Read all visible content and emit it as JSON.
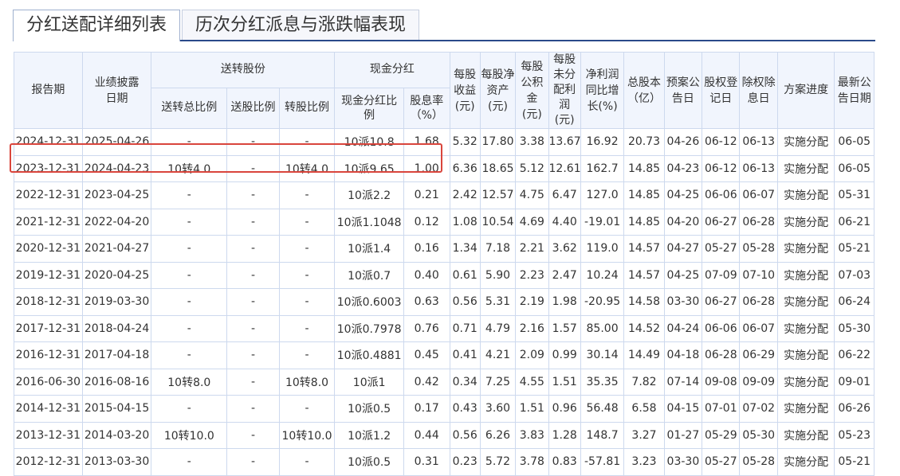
{
  "tabs": [
    {
      "label": "分红送配详细列表",
      "active": true
    },
    {
      "label": "历次分红派息与涨跌幅表现",
      "active": false
    }
  ],
  "header": {
    "report_period": "报告期",
    "disclosure_date": "业绩披露日期",
    "bonus_group": "送转股份",
    "bonus_total": "送转总比例",
    "bonus_ratio": "送股比例",
    "transfer_ratio": "转股比例",
    "cash_group": "现金分红",
    "cash_plan": "现金分红比例",
    "dividend_yield": "股息率（%）",
    "eps": "每股收益(元)",
    "bvps": "每股净资产(元)",
    "reserve": "每股公积金(元)",
    "undistributed": "每股未分配利润(元)",
    "profit_growth": "净利润同比增长(%)",
    "total_shares": "总股本（亿）",
    "plan_date": "预案公告日",
    "record_date": "股权登记日",
    "ex_date": "除权除息日",
    "progress": "方案进度",
    "latest_date": "最新公告日期"
  },
  "rows": [
    [
      "2024-12-31",
      "2025-04-26",
      "-",
      "-",
      "-",
      "10派10.8",
      "1.68",
      "5.32",
      "17.80",
      "3.38",
      "13.67",
      "16.92",
      "20.73",
      "04-26",
      "06-12",
      "06-13",
      "实施分配",
      "06-05"
    ],
    [
      "2023-12-31",
      "2024-04-23",
      "10转4.0",
      "-",
      "10转4.0",
      "10派9.65",
      "1.00",
      "6.36",
      "18.65",
      "5.12",
      "12.61",
      "162.7",
      "14.85",
      "04-23",
      "06-12",
      "06-13",
      "实施分配",
      "06-05"
    ],
    [
      "2022-12-31",
      "2023-04-25",
      "-",
      "-",
      "-",
      "10派2.2",
      "0.21",
      "2.42",
      "12.57",
      "4.75",
      "6.47",
      "127.0",
      "14.85",
      "04-25",
      "06-06",
      "06-07",
      "实施分配",
      "05-31"
    ],
    [
      "2021-12-31",
      "2022-04-20",
      "-",
      "-",
      "-",
      "10派1.1048",
      "0.12",
      "1.08",
      "10.54",
      "4.69",
      "4.40",
      "-19.01",
      "14.85",
      "04-20",
      "06-27",
      "06-28",
      "实施分配",
      "06-21"
    ],
    [
      "2020-12-31",
      "2021-04-27",
      "-",
      "-",
      "-",
      "10派1.4",
      "0.16",
      "1.34",
      "7.18",
      "2.21",
      "3.62",
      "119.0",
      "14.57",
      "04-27",
      "05-27",
      "05-28",
      "实施分配",
      "05-21"
    ],
    [
      "2019-12-31",
      "2020-04-25",
      "-",
      "-",
      "-",
      "10派0.7",
      "0.40",
      "0.61",
      "5.90",
      "2.23",
      "2.47",
      "10.24",
      "14.57",
      "04-25",
      "07-09",
      "07-10",
      "实施分配",
      "07-03"
    ],
    [
      "2018-12-31",
      "2019-03-30",
      "-",
      "-",
      "-",
      "10派0.6003",
      "0.63",
      "0.56",
      "5.31",
      "2.19",
      "1.98",
      "-20.95",
      "14.58",
      "03-30",
      "06-27",
      "06-28",
      "实施分配",
      "06-24"
    ],
    [
      "2017-12-31",
      "2018-04-24",
      "-",
      "-",
      "-",
      "10派0.7978",
      "0.76",
      "0.71",
      "4.79",
      "2.16",
      "1.57",
      "85.00",
      "14.52",
      "04-24",
      "06-06",
      "06-07",
      "实施分配",
      "05-30"
    ],
    [
      "2016-12-31",
      "2017-04-18",
      "-",
      "-",
      "-",
      "10派0.4881",
      "0.45",
      "0.41",
      "4.21",
      "2.09",
      "0.99",
      "30.14",
      "14.49",
      "04-18",
      "06-28",
      "06-29",
      "实施分配",
      "06-22"
    ],
    [
      "2016-06-30",
      "2016-08-16",
      "10转8.0",
      "-",
      "10转8.0",
      "10派1",
      "0.42",
      "0.34",
      "7.25",
      "4.55",
      "1.51",
      "35.35",
      "7.82",
      "07-14",
      "09-08",
      "09-09",
      "实施分配",
      "09-01"
    ],
    [
      "2014-12-31",
      "2015-04-15",
      "-",
      "-",
      "-",
      "10派0.5",
      "0.17",
      "0.43",
      "3.60",
      "1.51",
      "0.96",
      "56.48",
      "6.58",
      "04-15",
      "07-01",
      "07-02",
      "实施分配",
      "06-26"
    ],
    [
      "2013-12-31",
      "2014-03-20",
      "10转10.0",
      "-",
      "10转10.0",
      "10派1.2",
      "0.44",
      "0.56",
      "6.26",
      "3.83",
      "1.28",
      "148.7",
      "3.27",
      "01-27",
      "05-29",
      "05-30",
      "实施分配",
      "05-23"
    ],
    [
      "2012-12-31",
      "2013-03-30",
      "-",
      "-",
      "-",
      "10派0.5",
      "0.31",
      "0.23",
      "5.72",
      "3.78",
      "0.83",
      "-57.81",
      "3.23",
      "03-30",
      "05-27",
      "05-28",
      "实施分配",
      "05-21"
    ]
  ],
  "highlight_row": 1,
  "colors": {
    "tab_line": "#2a4a8a",
    "header_bg": "#f1f5fd",
    "border": "#cdd9ee",
    "highlight": "#d9453c"
  }
}
